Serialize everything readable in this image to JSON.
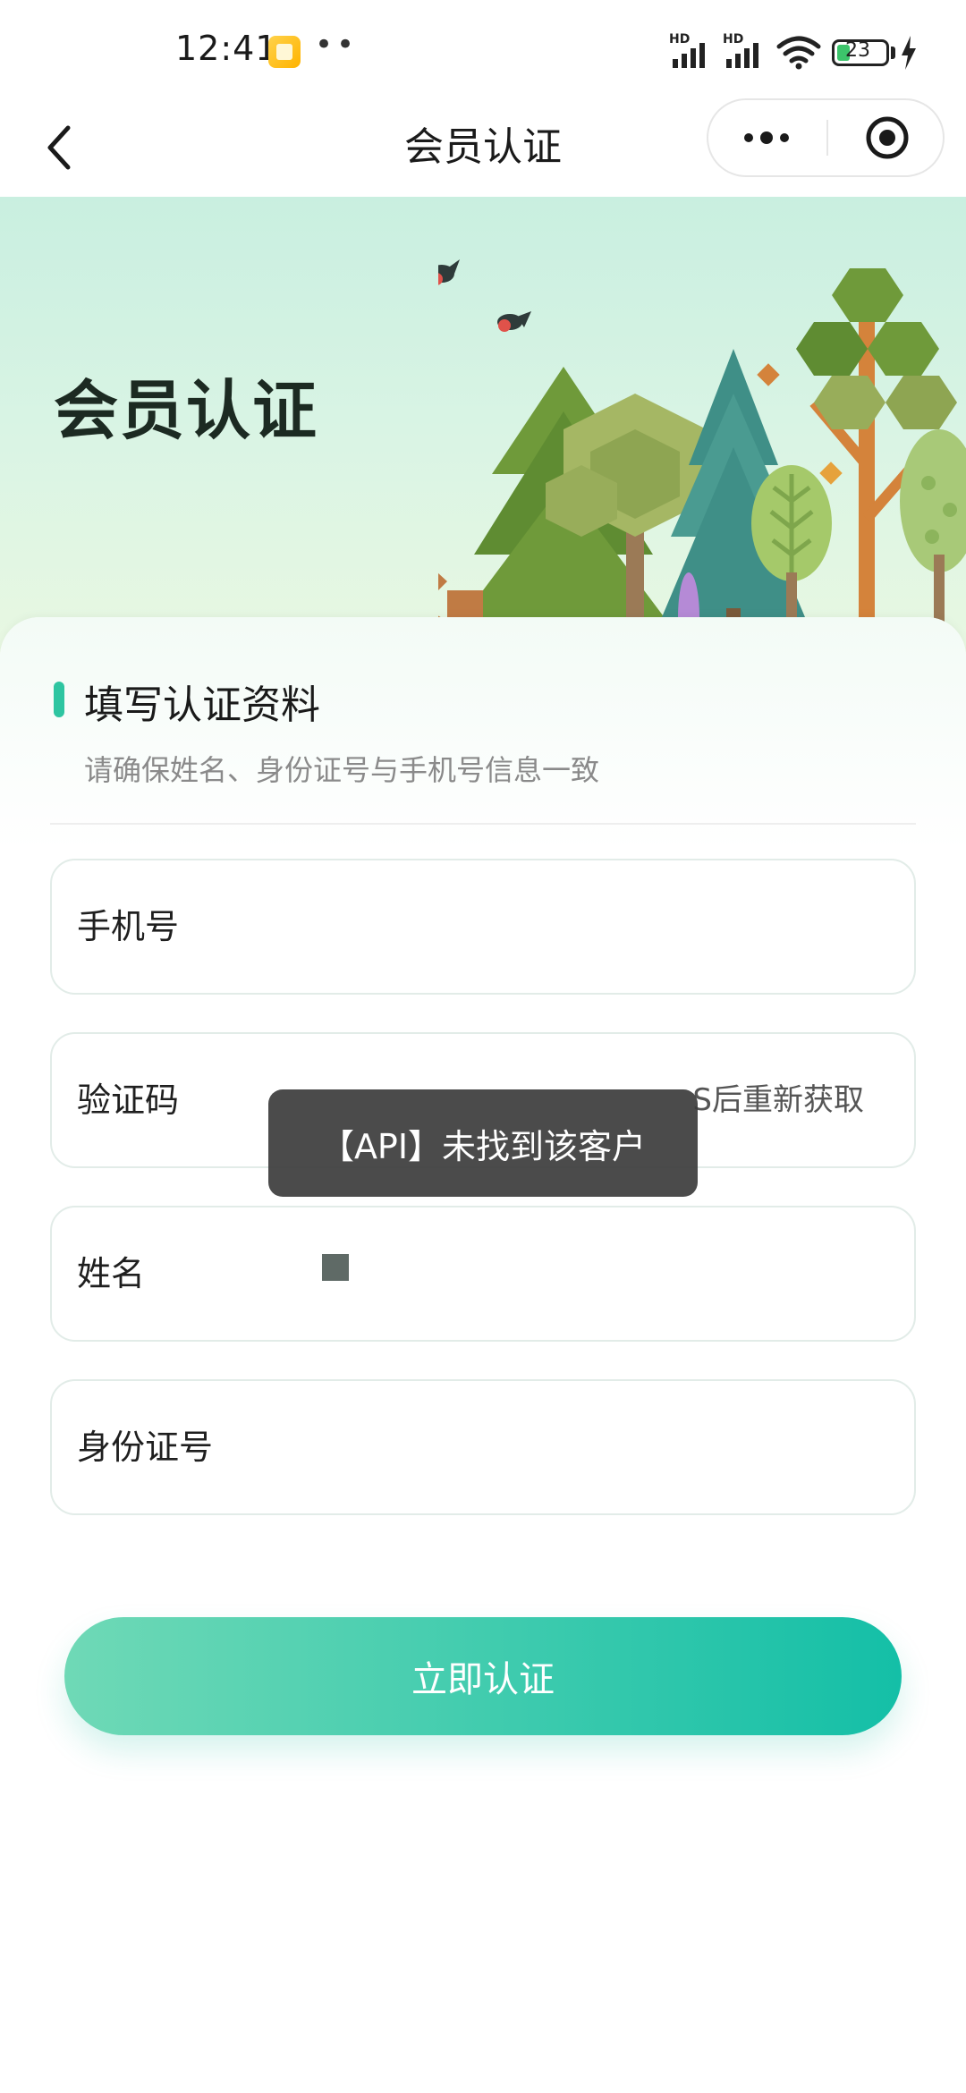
{
  "status_bar": {
    "time": "12:41",
    "dots": "••",
    "signal_1_label": "HD",
    "signal_2_label": "HD",
    "battery": "23"
  },
  "nav": {
    "title": "会员认证",
    "back_icon": "chevron-left-icon",
    "more_icon": "more-dots-icon",
    "close_icon": "target-close-icon"
  },
  "hero": {
    "title": "会员认证"
  },
  "form": {
    "section_title": "填写认证资料",
    "section_hint": "请确保姓名、身份证号与手机号信息一致",
    "fields": [
      {
        "label": "手机号",
        "value": ""
      },
      {
        "label": "验证码",
        "value": "",
        "resend": "S后重新获取"
      },
      {
        "label": "姓名",
        "value": ""
      },
      {
        "label": "身份证号",
        "value": ""
      }
    ],
    "submit_label": "立即认证"
  },
  "toast": {
    "message": "【API】未找到该客户"
  },
  "colors": {
    "accent": "#2ec5a1",
    "button_start": "#6fd9b6",
    "button_end": "#14bfa7",
    "hero_bg": "#d9f4e4"
  }
}
